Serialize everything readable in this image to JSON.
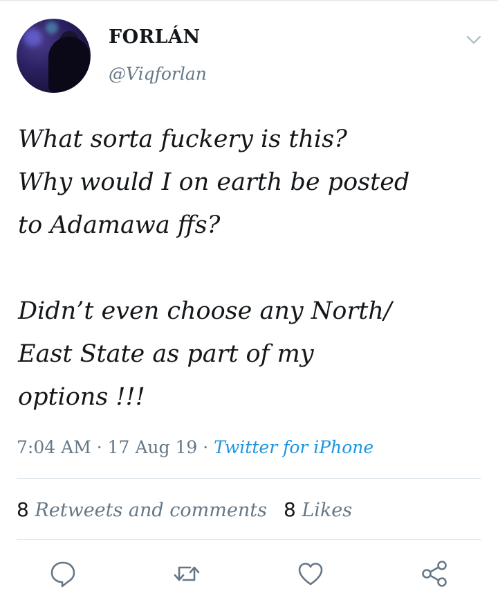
{
  "tweet": {
    "author": {
      "display_name": "FORLÁN",
      "handle": "@Viqforlan"
    },
    "text_paragraphs": [
      "What sorta fuckery is this?\nWhy would I on earth be posted\nto Adamawa ffs?",
      "Didn’t even choose any North/\nEast State as part of my\noptions !!!"
    ],
    "time": "7:04 AM",
    "date": "17 Aug 19",
    "separator": " · ",
    "source": "Twitter for iPhone",
    "stats": {
      "retweets_count": "8",
      "retweets_label": "Retweets and comments",
      "likes_count": "8",
      "likes_label": "Likes"
    }
  },
  "icons": {
    "menu": "chevron-down-icon",
    "reply": "reply-icon",
    "retweet": "retweet-icon",
    "like": "heart-icon",
    "share": "share-icon"
  },
  "colors": {
    "text": "#14171a",
    "secondary": "#657786",
    "link": "#1b95e0",
    "divider": "#e1e8ed"
  }
}
